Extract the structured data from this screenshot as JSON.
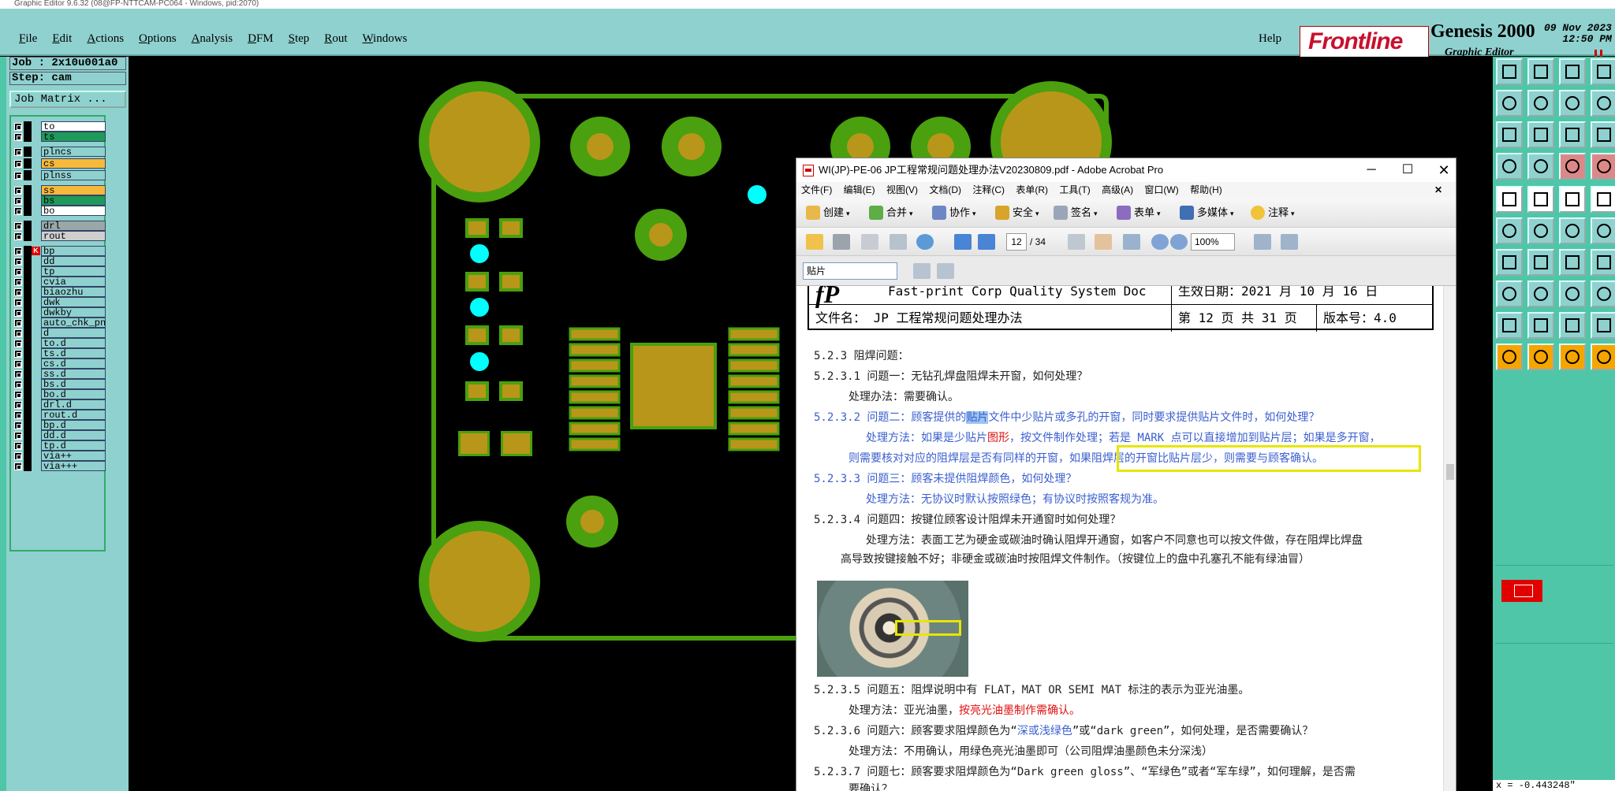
{
  "window_title": "Graphic Editor 9.6.32 (08@FP-NTTCAM-PC064 - Windows, pid:2070)",
  "menu": [
    "File",
    "Edit",
    "Actions",
    "Options",
    "Analysis",
    "DFM",
    "Step",
    "Rout",
    "Windows"
  ],
  "help": "Help",
  "brand": {
    "logo": "Frontline",
    "title": "Genesis 2000",
    "subtitle": "Graphic Editor",
    "date": "09 Nov 2023",
    "time": "12:50 PM"
  },
  "job": "Job : 2x10u001a0",
  "step": "Step: cam",
  "job_matrix": "Job Matrix ...",
  "layers": [
    {
      "name": "to",
      "color": "#ffffff"
    },
    {
      "name": "ts",
      "color": "#1f9a5a"
    },
    {
      "name": "plncs",
      "color": "#8fd1cf"
    },
    {
      "name": "cs",
      "color": "#f6b93b"
    },
    {
      "name": "plnss",
      "color": "#8fd1cf"
    },
    {
      "name": "ss",
      "color": "#f6b93b"
    },
    {
      "name": "bs",
      "color": "#1f9a5a"
    },
    {
      "name": "bo",
      "color": "#ffffff"
    },
    {
      "name": "drl",
      "color": "#9aa7a6"
    },
    {
      "name": "rout",
      "color": "#cfcfcf"
    },
    {
      "name": "bp",
      "color": "#8fd1cf"
    },
    {
      "name": "dd",
      "color": "#8fd1cf"
    },
    {
      "name": "tp",
      "color": "#8fd1cf"
    },
    {
      "name": "cvia",
      "color": "#8fd1cf"
    },
    {
      "name": "biaozhu",
      "color": "#8fd1cf"
    },
    {
      "name": "dwk",
      "color": "#8fd1cf"
    },
    {
      "name": "dwkby",
      "color": "#8fd1cf"
    },
    {
      "name": "auto_chk_pn",
      "color": "#8fd1cf"
    },
    {
      "name": "d",
      "color": "#8fd1cf"
    },
    {
      "name": "to.d",
      "color": "#8fd1cf"
    },
    {
      "name": "ts.d",
      "color": "#8fd1cf"
    },
    {
      "name": "cs.d",
      "color": "#8fd1cf"
    },
    {
      "name": "ss.d",
      "color": "#8fd1cf"
    },
    {
      "name": "bs.d",
      "color": "#8fd1cf"
    },
    {
      "name": "bo.d",
      "color": "#8fd1cf"
    },
    {
      "name": "drl.d",
      "color": "#8fd1cf"
    },
    {
      "name": "rout.d",
      "color": "#8fd1cf"
    },
    {
      "name": "bp.d",
      "color": "#8fd1cf"
    },
    {
      "name": "dd.d",
      "color": "#8fd1cf"
    },
    {
      "name": "tp.d",
      "color": "#8fd1cf"
    },
    {
      "name": "via++",
      "color": "#8fd1cf"
    },
    {
      "name": "via+++",
      "color": "#8fd1cf"
    }
  ],
  "coord_readout": "x = -0.443248\"",
  "acrobat": {
    "title": "WI(JP)-PE-06 JP工程常规问题处理办法V20230809.pdf - Adobe Acrobat Pro",
    "menu": [
      "文件(F)",
      "编辑(E)",
      "视图(V)",
      "文档(D)",
      "注释(C)",
      "表单(R)",
      "工具(T)",
      "高级(A)",
      "窗口(W)",
      "帮助(H)"
    ],
    "toolbar": [
      "创建",
      "合并",
      "协作",
      "安全",
      "签名",
      "表单",
      "多媒体",
      "注释"
    ],
    "page_current": "12",
    "page_total": "/ 34",
    "zoom": "100%",
    "bookmark_field": "贴片",
    "header": {
      "company": "Fast-print Corp Quality System Doc",
      "effective": "生效日期：2021 月 10 月 16 日",
      "filename": "文件名： JP 工程常规问题处理办法",
      "page": "第 12 页  共 31 页",
      "version": "版本号：4.0"
    },
    "lines": {
      "s523": "5.2.3 阻焊问题：",
      "s5231": "5.2.3.1 问题一：无钻孔焊盘阻焊未开窗，如何处理？",
      "s5231a": "处理办法：需要确认。",
      "s5232_pre": "5.2.3.2 问题二：顾客提供的",
      "s5232_sel": "贴片",
      "s5232_post": "文件中少贴片或多孔的开窗，同时要求提供贴片文件时，如何处理？",
      "s5232a_pre": "处理方法：如果是少贴片",
      "s5232a_red": "图形",
      "s5232a_post": "，按文件制作处理；若是 MARK 点可以直接增加到贴片层；如果是多开窗，",
      "s5232b_pre": "则需要核对对应的阻焊层是否有同样的开窗，",
      "s5232b_box": "如果阻焊层的开窗比贴片层少，则需要与顾客确认。",
      "s5233": "5.2.3.3 问题三：顾客未提供阻焊颜色，如何处理？",
      "s5233a": "处理方法：无协议时默认按照绿色；有协议时按照客规为准。",
      "s5234": "5.2.3.4 问题四：按键位顾客设计阻焊未开通窗时如何处理？",
      "s5234a": "处理方法：表面工艺为硬金或碳油时确认阻焊开通窗，如客户不同意也可以按文件做，存在阻焊比焊盘",
      "s5234b": "高导致按键接触不好；非硬金或碳油时按阻焊文件制作。（按键位上的盘中孔塞孔不能有绿油冒）",
      "s5235": "5.2.3.5 问题五：阻焊说明中有 FLAT，MAT OR SEMI MAT 标注的表示为亚光油墨。",
      "s5235a_pre": "处理方法：亚光油墨，",
      "s5235a_red": "按亮光油墨制作需确认。",
      "s5236_pre": "5.2.3.6 问题六：顾客要求阻焊颜色为“",
      "s5236_blue": "深或浅绿色",
      "s5236_post": "”或“dark green”，如何处理，是否需要确认？",
      "s5236a": "处理方法：不用确认，用绿色亮光油墨即可（公司阻焊油墨颜色未分深浅）",
      "s5237": "5.2.3.7 问题七：顾客要求阻焊颜色为“Dark green gloss”、“军绿色”或者“军车绿”，如何理解，是否需",
      "s5237b": "要确认？"
    }
  },
  "colors": {
    "pad": "#b8961a",
    "mask": "#4aa00e",
    "via": "#00ffff",
    "panel": "#8fd1cf",
    "accent_green": "#4fc6a7"
  }
}
